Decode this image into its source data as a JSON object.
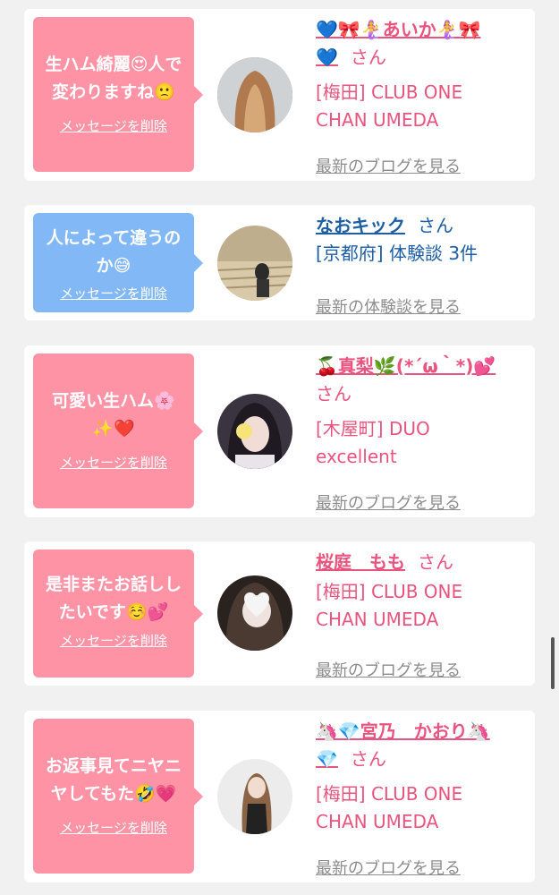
{
  "colors": {
    "pink_bubble": "#fe93a5",
    "blue_bubble": "#83b8f6",
    "pink_text": "#e9547e",
    "blue_text": "#1d5ea6"
  },
  "cards": [
    {
      "bubble_lines": [
        "生ハム綺麗😍人で",
        "変わりますね🙁"
      ],
      "delete_label": "メッセージを削除",
      "name_lines": [
        "💙🎀🧜‍♀️あいか🧜‍♀️🎀",
        "💙"
      ],
      "san": "さん",
      "shop_lines": [
        "[梅田] CLUB ONE",
        "CHAN UMEDA"
      ],
      "latest_link": "最新のブログを見る"
    },
    {
      "bubble_lines": [
        "人によって違うの",
        "か😅"
      ],
      "delete_label": "メッセージを削除",
      "name_lines": [
        "なおキック"
      ],
      "san": "さん",
      "shop_lines": [
        "[京都府] 体験談 3件"
      ],
      "latest_link": "最新の体験談を見る"
    },
    {
      "bubble_lines": [
        "可愛い生ハム🌸",
        "✨❤️"
      ],
      "delete_label": "メッセージを削除",
      "name_lines": [
        "🍒真梨🌿(*´ω｀*)💕"
      ],
      "san": "さん",
      "shop_lines": [
        "[木屋町] DUO",
        "excellent"
      ],
      "latest_link": "最新のブログを見る"
    },
    {
      "bubble_lines": [
        "是非またお話しし",
        "たいです☺️💕"
      ],
      "delete_label": "メッセージを削除",
      "name_lines": [
        "桜庭　もも"
      ],
      "san": "さん",
      "shop_lines": [
        "[梅田] CLUB ONE",
        "CHAN UMEDA"
      ],
      "latest_link": "最新のブログを見る"
    },
    {
      "bubble_lines": [
        "お返事見てニヤニ",
        "ヤしてもた🤣💗"
      ],
      "delete_label": "メッセージを削除",
      "name_lines": [
        "🦄💎宮乃　かおり🦄",
        "💎"
      ],
      "san": "さん",
      "shop_lines": [
        "[梅田] CLUB ONE",
        "CHAN UMEDA"
      ],
      "latest_link": "最新のブログを見る"
    }
  ]
}
